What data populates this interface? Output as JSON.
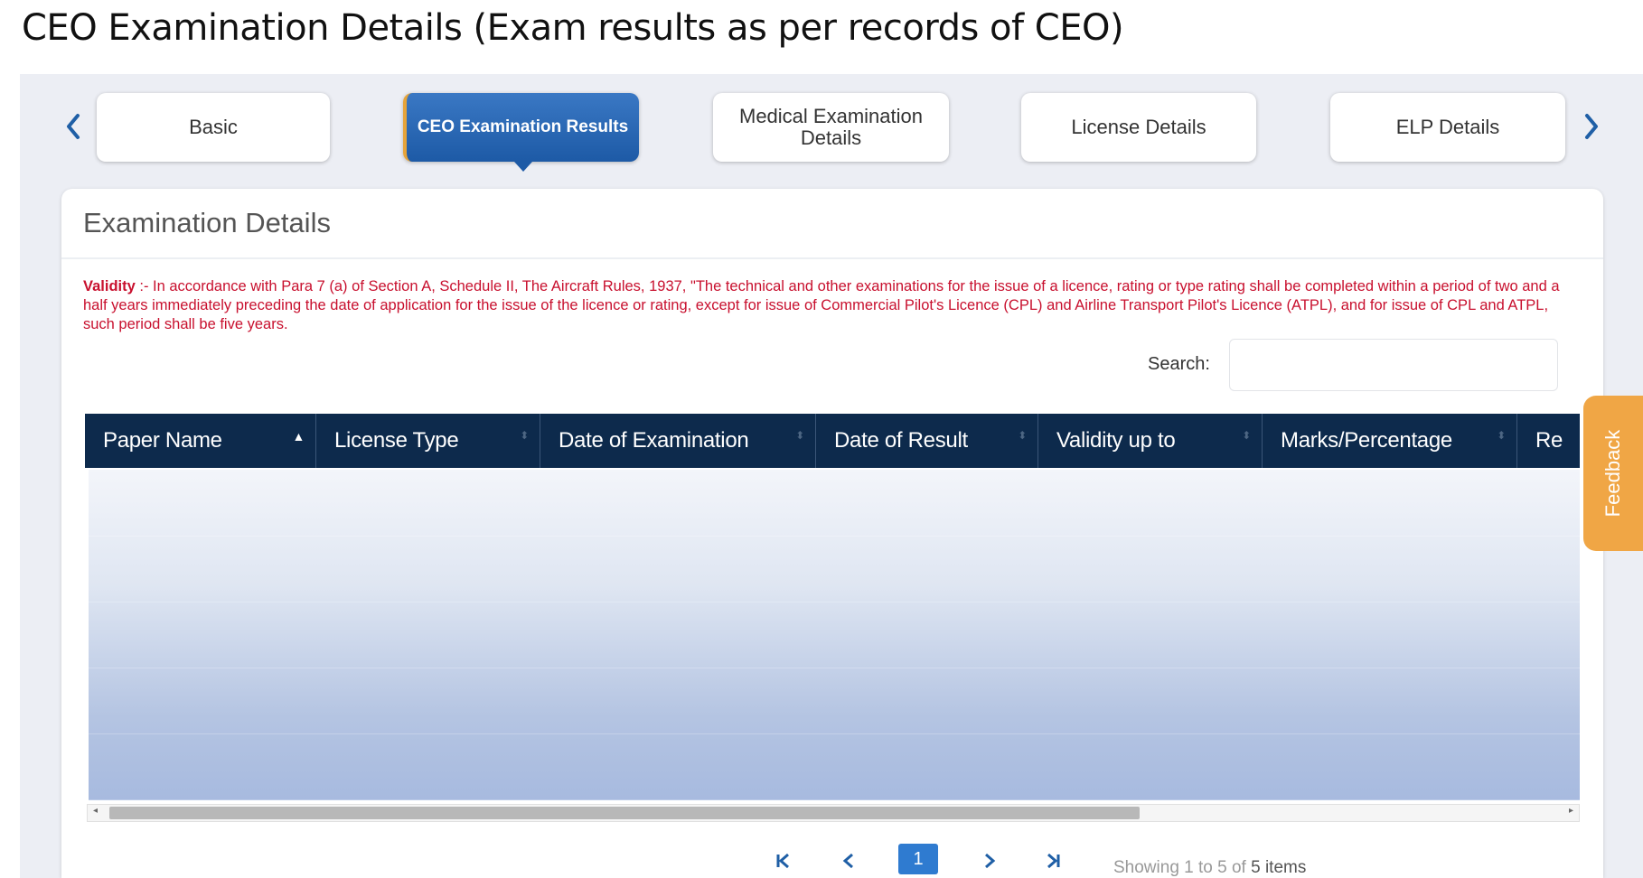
{
  "caption": "CEO Examination Details (Exam results as per records of CEO)",
  "tabs": [
    {
      "label": "Basic"
    },
    {
      "label": "CEO Examination Results"
    },
    {
      "label": "Medical Examination Details"
    },
    {
      "label": "License Details"
    },
    {
      "label": "ELP Details"
    }
  ],
  "active_tab": "CEO Examination Results",
  "panel": {
    "title": "Examination Details",
    "validity_label": "Validity",
    "validity_text": " :- In accordance with Para 7 (a) of Section A, Schedule II, The Aircraft Rules, 1937, \"The technical and other examinations for the issue of a licence, rating or type rating shall be completed within a period of two and a half years immediately preceding the date of application for the issue of the licence or rating, except for issue of Commercial Pilot's Licence (CPL) and Airline Transport Pilot's Licence (ATPL), and for issue of CPL and ATPL, such period shall be five years."
  },
  "search": {
    "label": "Search:",
    "value": "",
    "placeholder": ""
  },
  "table": {
    "columns": [
      "Paper Name",
      "License Type",
      "Date of Examination",
      "Date of Result",
      "Validity up to",
      "Marks/Percentage",
      "Re"
    ],
    "sorted_column": "Paper Name",
    "rows": []
  },
  "pagination": {
    "current_page": "1",
    "showing_prefix": "Showing 1 to 5 of ",
    "showing_count": "5 items"
  },
  "feedback_label": "Feedback",
  "colors": {
    "header_bg": "#0d2a4c",
    "active_tab": "#2a6bbb",
    "accent": "#1f5fa6",
    "validity_text": "#c8102e",
    "feedback": "#f0a645"
  },
  "icons": [
    "chevron-left-icon",
    "chevron-right-icon",
    "first-page-icon",
    "previous-page-icon",
    "next-page-icon",
    "last-page-icon",
    "sort-icon"
  ]
}
